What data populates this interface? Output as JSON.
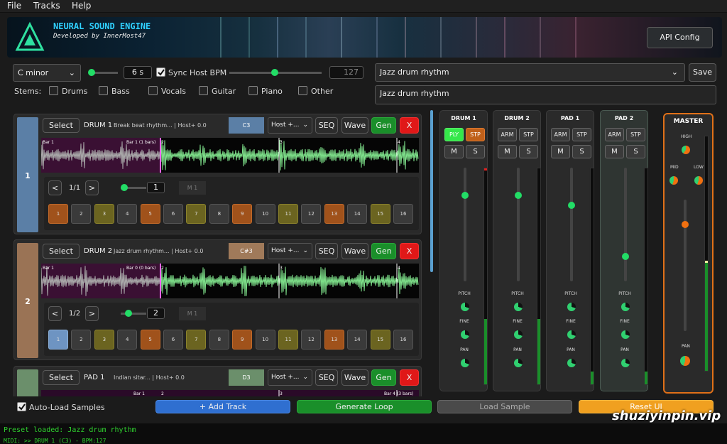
{
  "menu": {
    "file": "File",
    "tracks": "Tracks",
    "help": "Help"
  },
  "banner": {
    "title": "NEURAL SOUND ENGINE",
    "subtitle": "Developed by InnerMost47",
    "api_config": "API Config"
  },
  "controls": {
    "key": "C minor",
    "length": "6 s",
    "sync_label": "Sync Host BPM",
    "bpm": "127",
    "preset": "Jazz drum rhythm",
    "prompt": "Jazz drum rhythm",
    "save": "Save",
    "stems_label": "Stems:"
  },
  "stems": [
    "Drums",
    "Bass",
    "Vocals",
    "Guitar",
    "Piano",
    "Other"
  ],
  "tracks": [
    {
      "num": "1",
      "color": "#5b7fa6",
      "select": "Select",
      "name": "DRUM 1",
      "desc": "Break beat rhythm... | Host+ 0.0",
      "note": "C3",
      "note_color": "#5b7fa6",
      "mode": "Host +...",
      "seq": "SEQ",
      "wave": "Wave",
      "gen": "Gen",
      "del": "X",
      "marker_a": "Bar 1",
      "marker_b": "Bar 1 (1 bars)",
      "marker_b2": "2",
      "marker_c": "3",
      "marker_d": "4",
      "page": "1/1",
      "step_val": "1",
      "mute": "M 1",
      "pads": [
        {
          "n": "1",
          "s": "org"
        },
        {
          "n": "2",
          "s": "gray"
        },
        {
          "n": "3",
          "s": "yel"
        },
        {
          "n": "4",
          "s": "gray"
        },
        {
          "n": "5",
          "s": "org"
        },
        {
          "n": "6",
          "s": "gray"
        },
        {
          "n": "7",
          "s": "yel"
        },
        {
          "n": "8",
          "s": "gray"
        },
        {
          "n": "9",
          "s": "org"
        },
        {
          "n": "10",
          "s": "gray"
        },
        {
          "n": "11",
          "s": "yel"
        },
        {
          "n": "12",
          "s": "gray"
        },
        {
          "n": "13",
          "s": "org"
        },
        {
          "n": "14",
          "s": "gray"
        },
        {
          "n": "15",
          "s": "yel"
        },
        {
          "n": "16",
          "s": "gray"
        }
      ]
    },
    {
      "num": "2",
      "color": "#9a7355",
      "select": "Select",
      "name": "DRUM 2",
      "desc": "Jazz drum rhythm... | Host+ 0.0",
      "note": "C#3",
      "note_color": "#a07a5a",
      "mode": "Host +...",
      "seq": "SEQ",
      "wave": "Wave",
      "gen": "Gen",
      "del": "X",
      "marker_a": "Bar 1",
      "marker_b": "Bar 0 (0 bars)",
      "marker_b2": "2",
      "marker_c": "3",
      "marker_d": "4",
      "page": "1/2",
      "step_val": "2",
      "mute": "M 1",
      "pads": [
        {
          "n": "1",
          "s": "blu"
        },
        {
          "n": "2",
          "s": "gray"
        },
        {
          "n": "3",
          "s": "yel"
        },
        {
          "n": "4",
          "s": "gray"
        },
        {
          "n": "5",
          "s": "org"
        },
        {
          "n": "6",
          "s": "gray"
        },
        {
          "n": "7",
          "s": "yel"
        },
        {
          "n": "8",
          "s": "gray"
        },
        {
          "n": "9",
          "s": "org"
        },
        {
          "n": "10",
          "s": "gray"
        },
        {
          "n": "11",
          "s": "yel"
        },
        {
          "n": "12",
          "s": "gray"
        },
        {
          "n": "13",
          "s": "org"
        },
        {
          "n": "14",
          "s": "gray"
        },
        {
          "n": "15",
          "s": "yel"
        },
        {
          "n": "16",
          "s": "gray"
        }
      ]
    },
    {
      "num": "",
      "color": "#6b8f6b",
      "select": "Select",
      "name": "PAD 1",
      "desc": "Indian sitar... | Host+ 0.0",
      "note": "D3",
      "note_color": "#6b8f6b",
      "mode": "Host +...",
      "seq": "SEQ",
      "wave": "Wave",
      "gen": "Gen",
      "del": "X",
      "marker_a": "Bar 1",
      "marker_b": "2",
      "marker_c": "3",
      "marker_d": "Bar 4 (3 bars)"
    }
  ],
  "mixer": [
    {
      "name": "DRUM 1",
      "b1": "PLY",
      "b2": "STP",
      "m": "M",
      "s": "S",
      "pitch": "PITCH",
      "fine": "FINE",
      "pan": "PAN",
      "level": 0.85
    },
    {
      "name": "DRUM 2",
      "b1": "ARM",
      "b2": "STP",
      "m": "M",
      "s": "S",
      "pitch": "PITCH",
      "fine": "FINE",
      "pan": "PAN",
      "level": 0.85
    },
    {
      "name": "PAD 1",
      "b1": "ARM",
      "b2": "STP",
      "m": "M",
      "s": "S",
      "pitch": "PITCH",
      "fine": "FINE",
      "pan": "PAN",
      "level": 0.7
    },
    {
      "name": "PAD 2",
      "b1": "ARM",
      "b2": "STP",
      "m": "M",
      "s": "S",
      "pitch": "PITCH",
      "fine": "FINE",
      "pan": "PAN",
      "level": 0.25
    }
  ],
  "master": {
    "title": "MASTER",
    "high": "HIGH",
    "mid": "MID",
    "low": "LOW",
    "pan": "PAN"
  },
  "bottom": {
    "autoload": "Auto-Load Samples",
    "add_track": "+ Add Track",
    "generate": "Generate Loop",
    "load_sample": "Load Sample",
    "reset": "Reset UI"
  },
  "status": {
    "line1": "Preset loaded: Jazz drum rhythm",
    "line2": "MIDI: >> DRUM 1 (C3) - BPM:127"
  },
  "watermark": "shuziyinpin.vip",
  "colors": {
    "accent_green": "#1a8f2a",
    "accent_red": "#e01818",
    "accent_blue": "#2f6fd0",
    "accent_orange": "#f0a020",
    "master_border": "#e07018",
    "status_green": "#2fd02f"
  }
}
